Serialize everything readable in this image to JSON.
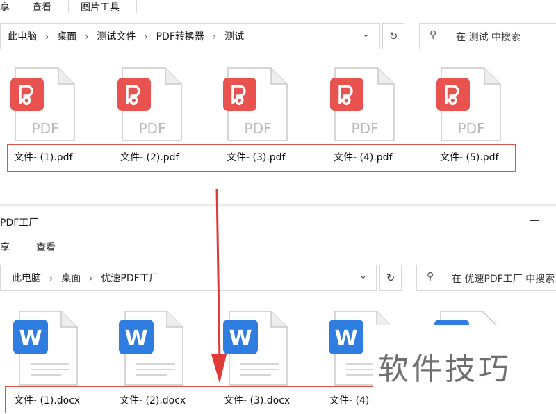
{
  "top": {
    "tabs": [
      "享",
      "查看",
      "图片工具"
    ],
    "breadcrumb": [
      "此电脑",
      "桌面",
      "测试文件",
      "PDF转换器",
      "测试"
    ],
    "search_placeholder": "在 测试 中搜索",
    "files": [
      "文件- (1).pdf",
      "文件- (2).pdf",
      "文件- (3).pdf",
      "文件- (4).pdf",
      "文件- (5).pdf"
    ],
    "pdf_label": "PDF"
  },
  "bottom": {
    "window_title": "PDF工厂",
    "tabs": [
      "享",
      "查看"
    ],
    "breadcrumb": [
      "此电脑",
      "桌面",
      "优速PDF工厂"
    ],
    "search_placeholder": "在 优速PDF工厂 中搜索",
    "files": [
      "文件- (1).docx",
      "文件- (2).docx",
      "文件- (3).docx",
      "文件- (4)"
    ],
    "word_letter": "W"
  },
  "watermark": "软件技巧",
  "colors": {
    "pdf_red": "#e8534f",
    "word_blue": "#2f7de1",
    "highlight_red": "#e0524d",
    "arrow_red": "#e23a36"
  }
}
